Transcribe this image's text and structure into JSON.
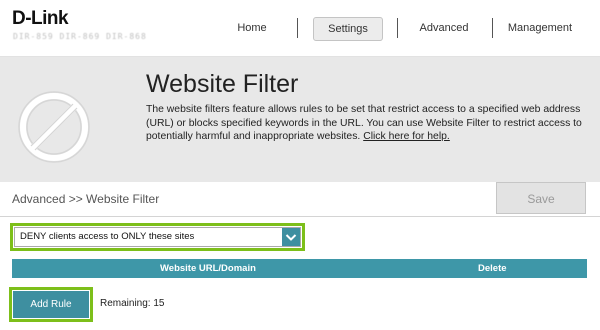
{
  "header": {
    "logo": "D-Link",
    "logo_sub": "DIR-859 DIR-869 DIR-868",
    "nav": [
      "Home",
      "Settings",
      "Advanced",
      "Management"
    ],
    "active_nav": "Settings"
  },
  "page": {
    "title": "Website Filter",
    "description": "The website filters feature allows rules to be set that restrict access to a specified web address (URL) or blocks specified keywords in the URL. You can use Website Filter to restrict access to potentially harmful and inappropriate websites.",
    "help_link": "Click here for help.",
    "breadcrumb": "Advanced >> Website Filter",
    "save_label": "Save"
  },
  "filter": {
    "mode_value": "DENY clients access to ONLY these sites"
  },
  "table": {
    "columns": [
      "Website URL/Domain",
      "Delete"
    ]
  },
  "footer": {
    "add_rule_label": "Add Rule",
    "remaining_text": "Remaining: 15"
  },
  "colors": {
    "accent": "#3e8fa0",
    "highlight": "#7dbf1a",
    "band": "#e8e8e8"
  }
}
